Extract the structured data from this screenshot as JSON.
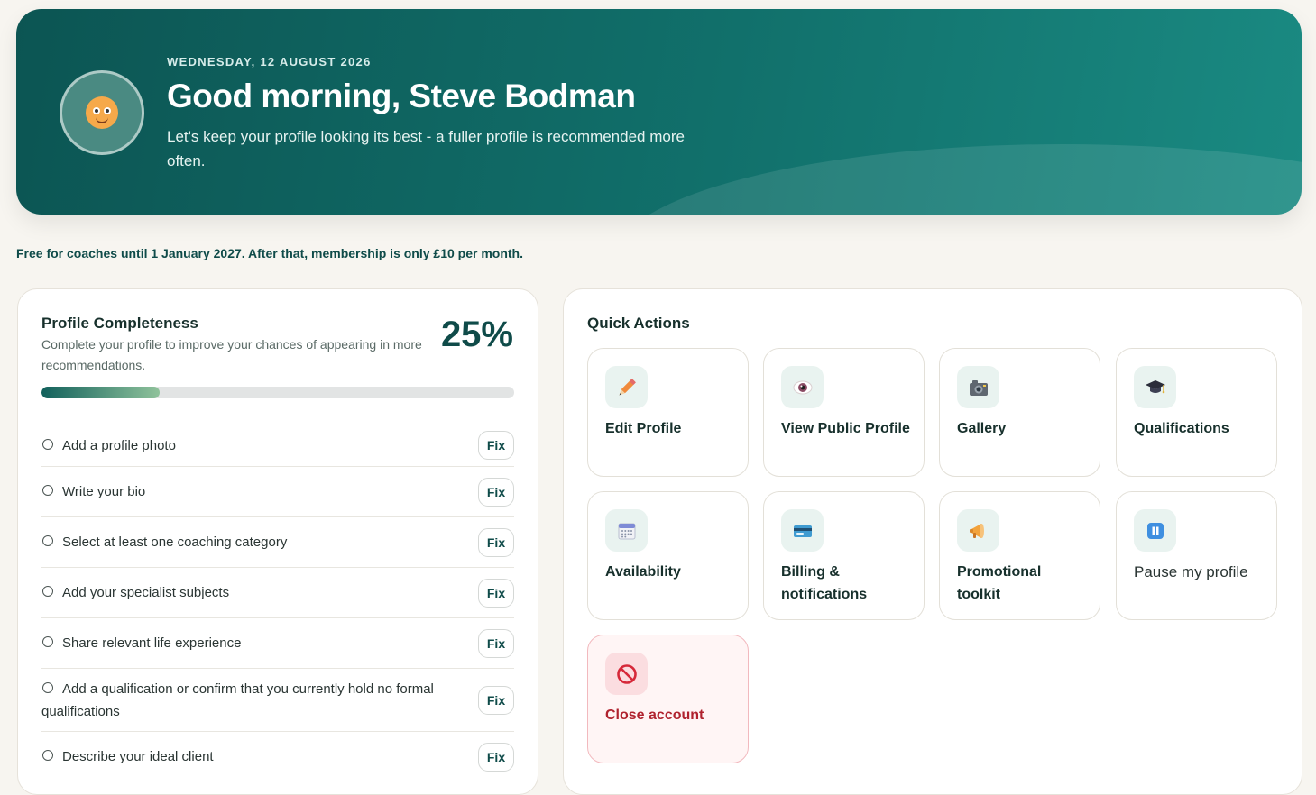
{
  "header": {
    "date": "WEDNESDAY, 12 AUGUST 2026",
    "greeting": "Good morning, Steve Bodman",
    "subtitle": "Let's keep your profile looking its best - a fuller profile is recommended more often.",
    "avatar_icon": "smiling-face-icon"
  },
  "notice": "Free for coaches until 1 January 2027. After that, membership is only £10 per month.",
  "profile": {
    "title": "Profile Completeness",
    "description": "Complete your profile to improve your chances of appearing in more recommendations.",
    "percent_label": "25%",
    "progress": 0.25,
    "fix_label": "Fix",
    "tasks": [
      {
        "label": "Add a profile photo"
      },
      {
        "label": "Write your bio"
      },
      {
        "label": "Select at least one coaching category"
      },
      {
        "label": "Add your specialist subjects"
      },
      {
        "label": "Share relevant life experience"
      },
      {
        "label": "Add a qualification or confirm that you currently hold no formal qualifications"
      },
      {
        "label": "Describe your ideal client"
      }
    ]
  },
  "quick_actions": {
    "title": "Quick Actions",
    "items": [
      {
        "label": "Edit Profile",
        "icon": "pencil-icon"
      },
      {
        "label": "View Public Profile",
        "icon": "eye-icon"
      },
      {
        "label": "Gallery",
        "icon": "camera-icon"
      },
      {
        "label": "Qualifications",
        "icon": "graduation-cap-icon"
      },
      {
        "label": "Availability",
        "icon": "calendar-icon"
      },
      {
        "label": "Billing & notifications",
        "icon": "credit-card-icon"
      },
      {
        "label": "Promotional toolkit",
        "icon": "megaphone-icon"
      },
      {
        "label": "Pause my profile",
        "icon": "pause-icon"
      },
      {
        "label": "Close account",
        "icon": "prohibited-icon"
      }
    ]
  },
  "colors": {
    "hero_start": "#0c5553",
    "hero_end": "#1a8a82",
    "accent": "#0f4b49",
    "danger": "#b0232f",
    "background": "#f7f5f0"
  }
}
